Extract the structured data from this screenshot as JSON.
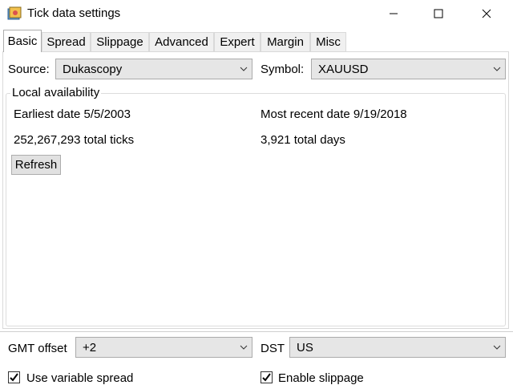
{
  "window": {
    "title": "Tick data settings",
    "icon": "app-icon",
    "controls": [
      "minimize-icon",
      "maximize-icon",
      "close-icon"
    ]
  },
  "tabs": [
    {
      "label": "Basic",
      "active": true
    },
    {
      "label": "Spread"
    },
    {
      "label": "Slippage"
    },
    {
      "label": "Advanced"
    },
    {
      "label": "Expert"
    },
    {
      "label": "Margin"
    },
    {
      "label": "Misc"
    }
  ],
  "source": {
    "label": "Source:",
    "value": "Dukascopy"
  },
  "symbol": {
    "label": "Symbol:",
    "value": "XAUUSD"
  },
  "local": {
    "title": "Local availability",
    "earliest": "Earliest date 5/5/2003",
    "recent": "Most recent date 9/19/2018",
    "ticks": "252,267,293 total ticks",
    "days": "3,921 total days",
    "refresh_label": "Refresh"
  },
  "gmt": {
    "label": "GMT offset",
    "value": "+2"
  },
  "dst": {
    "label": "DST",
    "value": "US"
  },
  "checks": {
    "variable_spread": {
      "label": "Use variable spread",
      "checked": true
    },
    "slippage": {
      "label": "Enable slippage",
      "checked": true
    }
  },
  "colors": {
    "combo_bg": "#e6e6e6",
    "panel_border": "#d9d9d9",
    "button_bg": "#e1e1e1"
  }
}
